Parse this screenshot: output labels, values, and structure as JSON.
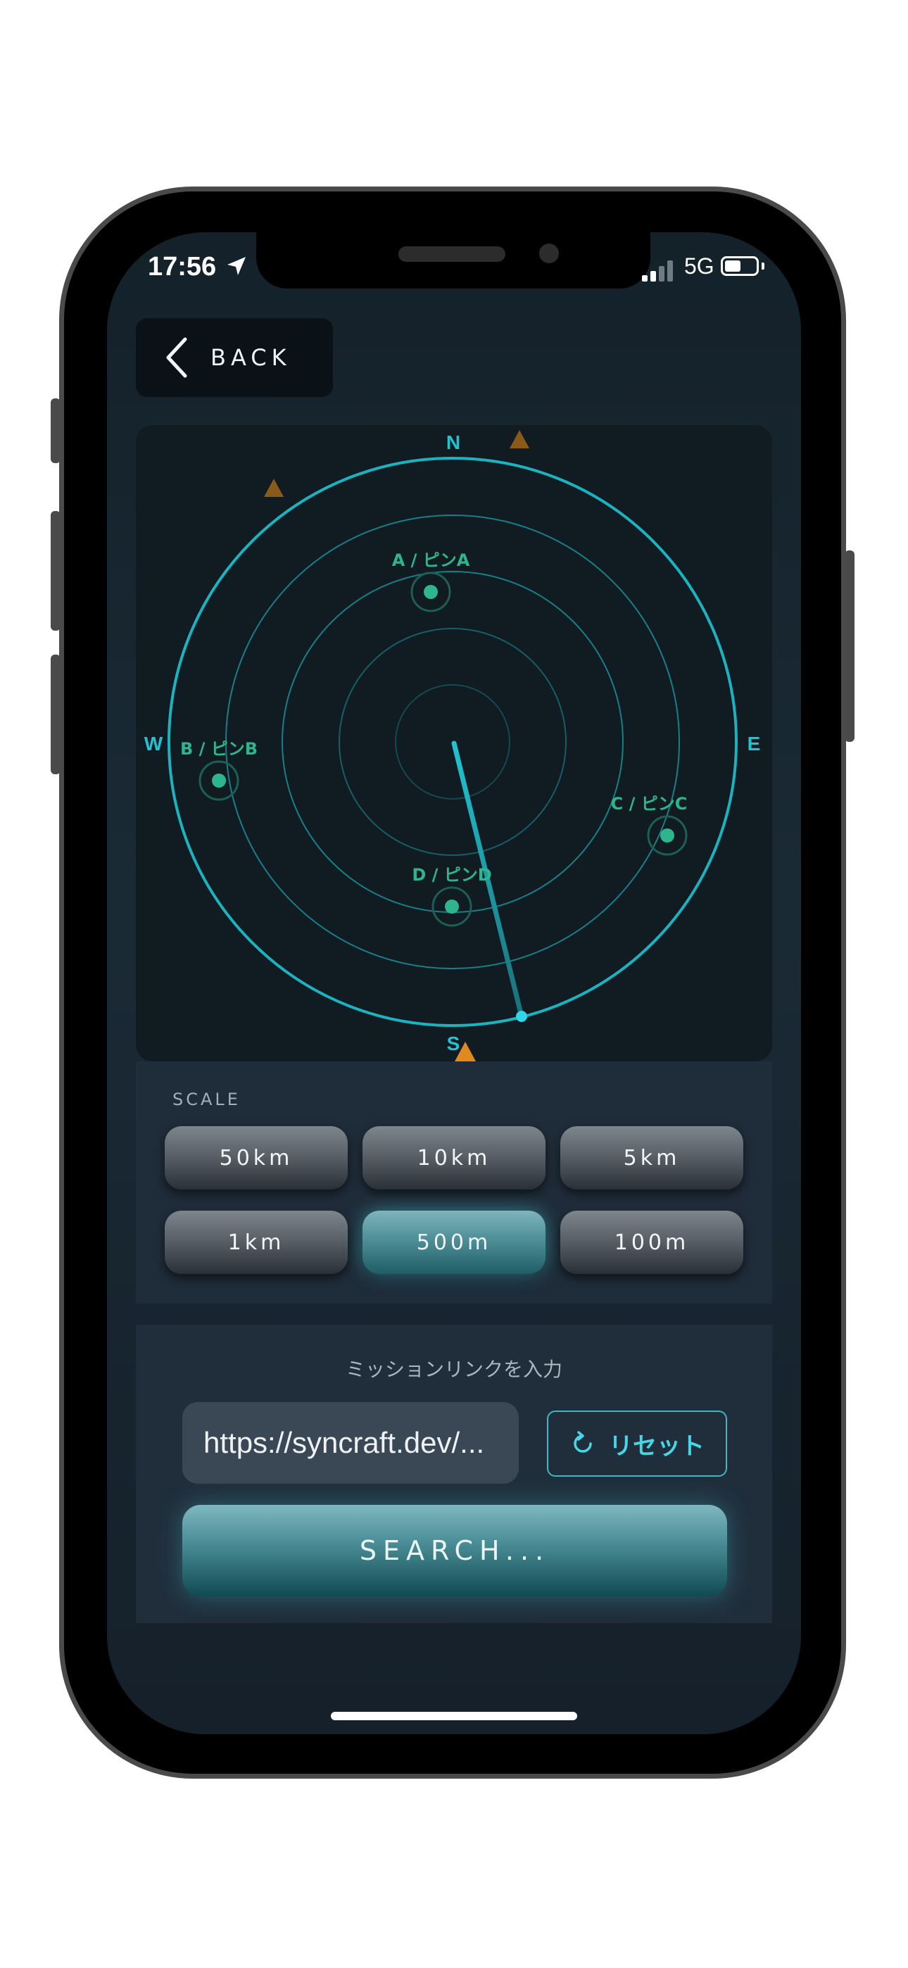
{
  "status_bar": {
    "time": "17:56",
    "network": "5G",
    "location_icon": "location-arrow-icon",
    "signal_icon": "signal-bars-icon",
    "battery_icon": "battery-icon"
  },
  "header": {
    "back_label": "BACK",
    "back_icon": "chevron-left-icon"
  },
  "radar": {
    "directions": {
      "north": "N",
      "south": "S",
      "east": "E",
      "west": "W"
    },
    "pins": [
      {
        "label": "A / ピンA"
      },
      {
        "label": "B / ピンB"
      },
      {
        "label": "C / ピンC"
      },
      {
        "label": "D / ピンD"
      }
    ],
    "colors": {
      "ring": "#1bb3bf",
      "pin": "#2fb58e",
      "marker": "#e08a1e"
    }
  },
  "scale": {
    "title": "SCALE",
    "options": [
      "50km",
      "10km",
      "5km",
      "1km",
      "500m",
      "100m"
    ],
    "selected": "500m"
  },
  "mission": {
    "title": "ミッションリンクを入力",
    "url_value": "https://syncraft.dev/...",
    "reset_label": "リセット",
    "reset_icon": "refresh-icon",
    "search_label": "SEARCH..."
  }
}
